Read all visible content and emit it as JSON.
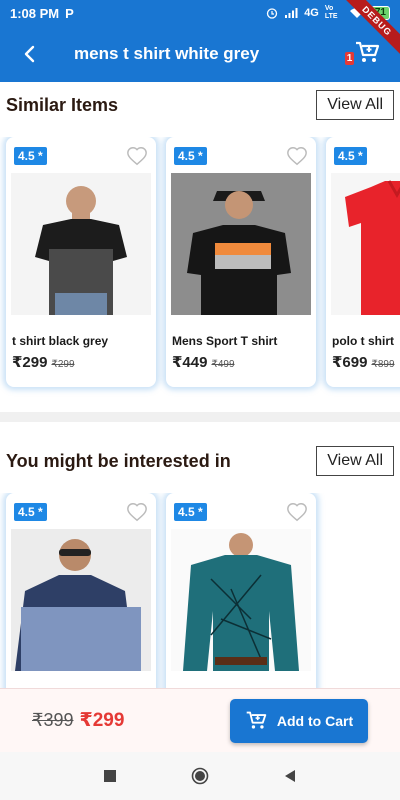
{
  "status_bar": {
    "time": "1:08 PM",
    "network": "4G",
    "lte": "Vo LTE",
    "battery": "71"
  },
  "app_bar": {
    "title": "mens t shirt white grey",
    "cart_count": "1",
    "debug_label": "DEBUG"
  },
  "similar": {
    "title": "Similar Items",
    "view_all": "View All",
    "items": [
      {
        "rating": "4.5 *",
        "name": "t shirt black grey",
        "price": "₹299",
        "mrp": "₹299"
      },
      {
        "rating": "4.5 *",
        "name": "Mens Sport T shirt",
        "price": "₹449",
        "mrp": "₹499"
      },
      {
        "rating": "4.5 *",
        "name": "polo t shirt",
        "price": "₹699",
        "mrp": "₹899"
      }
    ]
  },
  "interested": {
    "title": "You might be interested in",
    "view_all": "View All",
    "items": [
      {
        "rating": "4.5 *"
      },
      {
        "rating": "4.5 *"
      }
    ]
  },
  "bottom_bar": {
    "old_price": "₹399",
    "new_price": "₹299",
    "add_to_cart": "Add to Cart"
  },
  "colors": {
    "primary": "#1976d2",
    "accent_red": "#e53935",
    "rating_blue": "#1e88e5"
  }
}
